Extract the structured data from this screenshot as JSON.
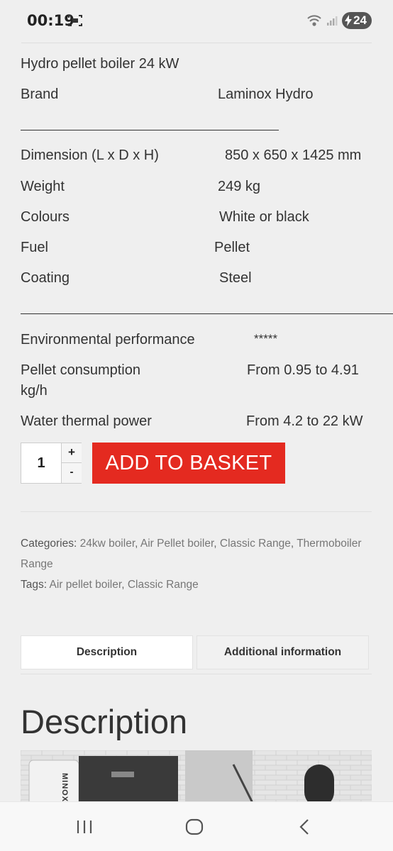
{
  "status": {
    "time": "00:19",
    "battery": "24"
  },
  "specs": {
    "title": "Hydro pellet boiler 24 kW",
    "brand": {
      "label": "Brand",
      "value": "Laminox Hydro"
    },
    "divider1": "_________________________________",
    "dimension": {
      "label": "Dimension (L x D x H)",
      "value": "850 x 650 x 1425 mm"
    },
    "weight": {
      "label": "Weight",
      "value": "249 kg"
    },
    "colours": {
      "label": "Colours",
      "value": "White or black"
    },
    "fuel": {
      "label": "Fuel",
      "value": "Pellet"
    },
    "coating": {
      "label": "Coating",
      "value": "Steel"
    },
    "divider2": "______________________________________________",
    "environmental": {
      "label": "Environmental performance",
      "value": "*****"
    },
    "pellet": {
      "label_line1": "Pellet consumption",
      "label_line2": "kg/h",
      "value": "From 0.95 to 4.91"
    },
    "thermal": {
      "label": "Water thermal power",
      "value": "From 4.2 to 22 kW"
    }
  },
  "cart": {
    "quantity": "1",
    "plus": "+",
    "minus": "-",
    "add_label": "ADD TO BASKET"
  },
  "meta": {
    "categories_label": "Categories:",
    "categories": [
      "24kw boiler",
      "Air Pellet boiler",
      "Classic Range",
      "Thermoboiler Range"
    ],
    "tags_label": "Tags:",
    "tags": [
      "Air pellet boiler",
      "Classic Range"
    ]
  },
  "tabs": [
    {
      "label": "Description"
    },
    {
      "label": "Additional information"
    }
  ],
  "description": {
    "heading": "Description",
    "image_text": "MINOX"
  },
  "colors": {
    "accent": "#e42a20",
    "background": "#efefef"
  }
}
